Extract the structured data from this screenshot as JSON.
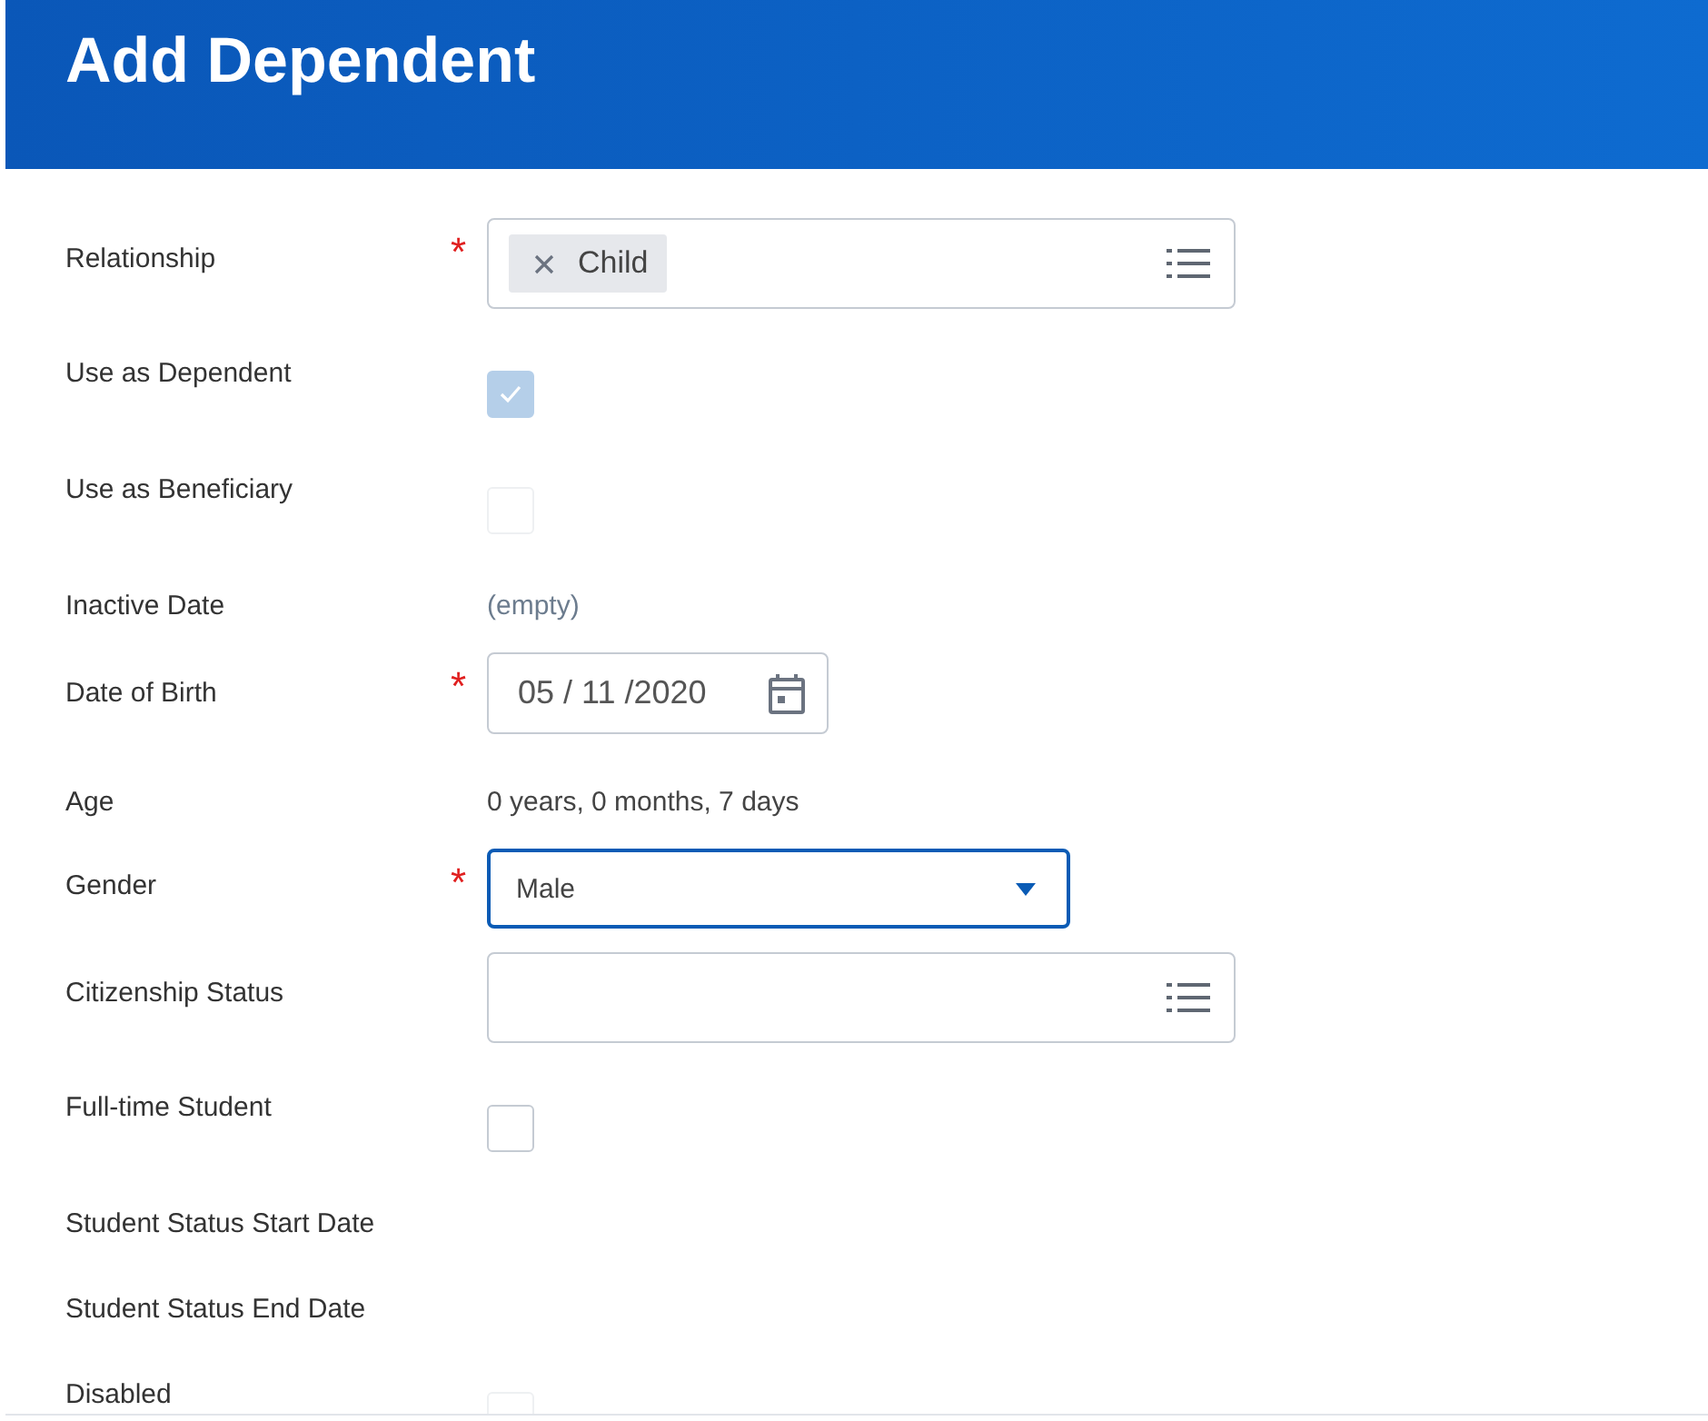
{
  "header": {
    "title": "Add Dependent"
  },
  "fields": [
    {
      "label": "Relationship",
      "kind": "multiselect",
      "asterisk": "*",
      "tags": [
        "Child"
      ]
    },
    {
      "label": "Use as Dependent",
      "kind": "checkbox",
      "checked": true,
      "disabled": true
    },
    {
      "label": "Use as Beneficiary",
      "kind": "checkbox",
      "checked": false,
      "disabled": true
    },
    {
      "label": "Inactive Date",
      "kind": "text",
      "value": "(empty)",
      "muted": true
    },
    {
      "label": "Date of Birth",
      "kind": "date",
      "asterisk": "*",
      "value": "05 / 11 /2020"
    },
    {
      "label": "Age",
      "kind": "text",
      "value": "0 years, 0 months, 7 days",
      "muted": false
    },
    {
      "label": "Gender",
      "kind": "select",
      "asterisk": "*",
      "value": "Male",
      "focused": true
    },
    {
      "label": "Citizenship Status",
      "kind": "multiselect"
    },
    {
      "label": "Full-time Student",
      "kind": "checkbox",
      "checked": false,
      "disabled": false
    },
    {
      "label": "Student Status Start Date",
      "kind": "none"
    },
    {
      "label": "Student Status End Date",
      "kind": "none"
    },
    {
      "label": "Disabled",
      "kind": "checkbox",
      "checked": false,
      "disabled": true
    }
  ]
}
